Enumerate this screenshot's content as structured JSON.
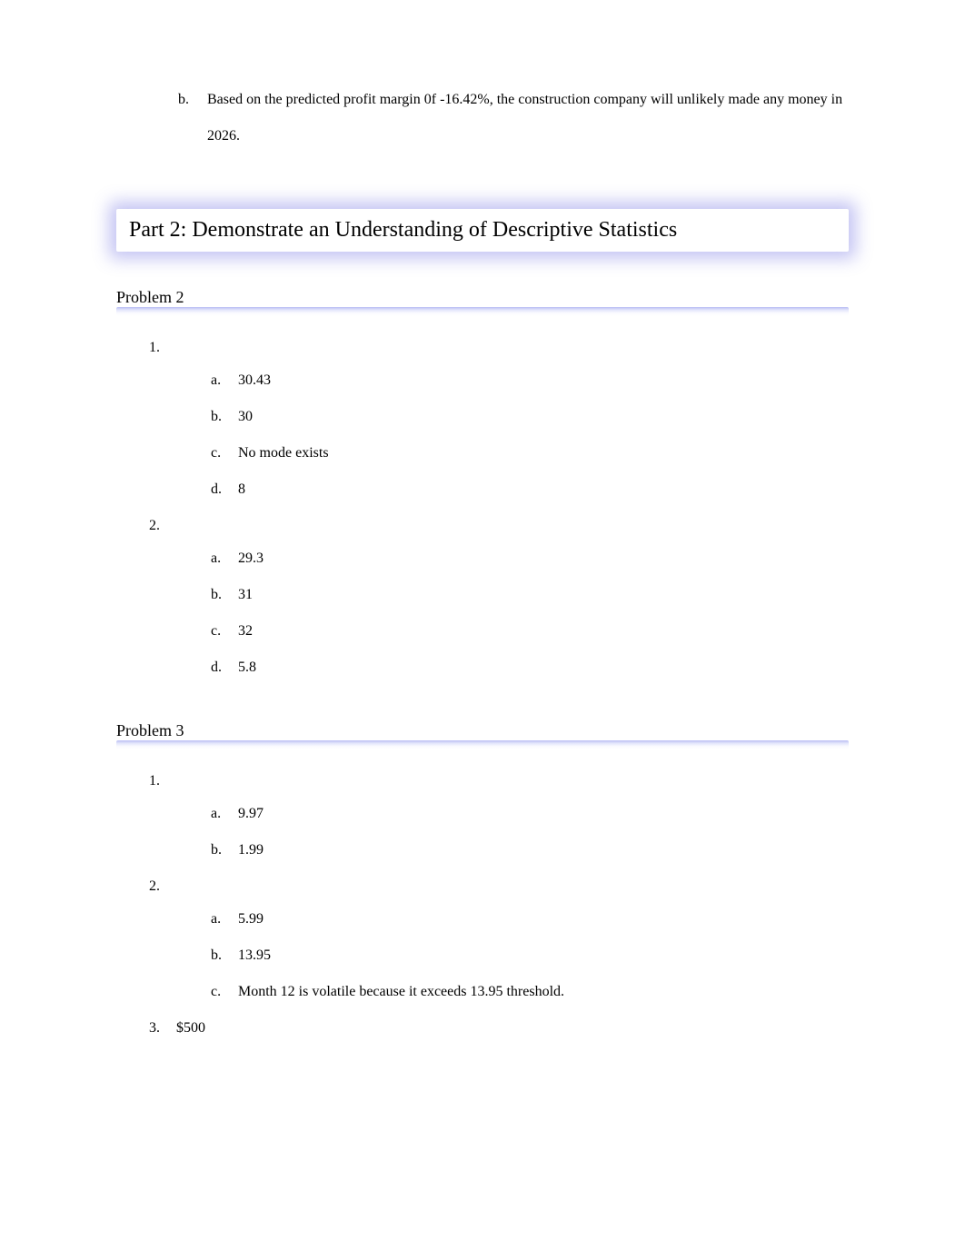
{
  "intro": {
    "item_b_marker": "b.",
    "item_b_text": "Based on the predicted profit margin 0f -16.42%, the construction company will unlikely made any money in 2026."
  },
  "part2": {
    "heading": "Part 2: Demonstrate an Understanding of Descriptive Statistics"
  },
  "problem2": {
    "heading": "Problem 2",
    "q1": {
      "marker": "1.",
      "a_marker": "a.",
      "a_text": "30.43",
      "b_marker": "b.",
      "b_text": "30",
      "c_marker": "c.",
      "c_text": "No mode exists",
      "d_marker": "d.",
      "d_text": "8"
    },
    "q2": {
      "marker": "2.",
      "a_marker": "a.",
      "a_text": "29.3",
      "b_marker": "b.",
      "b_text": "31",
      "c_marker": "c.",
      "c_text": "32",
      "d_marker": "d.",
      "d_text": "5.8"
    }
  },
  "problem3": {
    "heading": "Problem 3",
    "q1": {
      "marker": "1.",
      "a_marker": "a.",
      "a_text": "9.97",
      "b_marker": "b.",
      "b_text": "1.99"
    },
    "q2": {
      "marker": "2.",
      "a_marker": "a.",
      "a_text": "5.99",
      "b_marker": "b.",
      "b_text": "13.95",
      "c_marker": "c.",
      "c_text": "Month 12 is volatile because it exceeds 13.95 threshold."
    },
    "q3": {
      "marker": "3.",
      "text": "$500"
    }
  }
}
